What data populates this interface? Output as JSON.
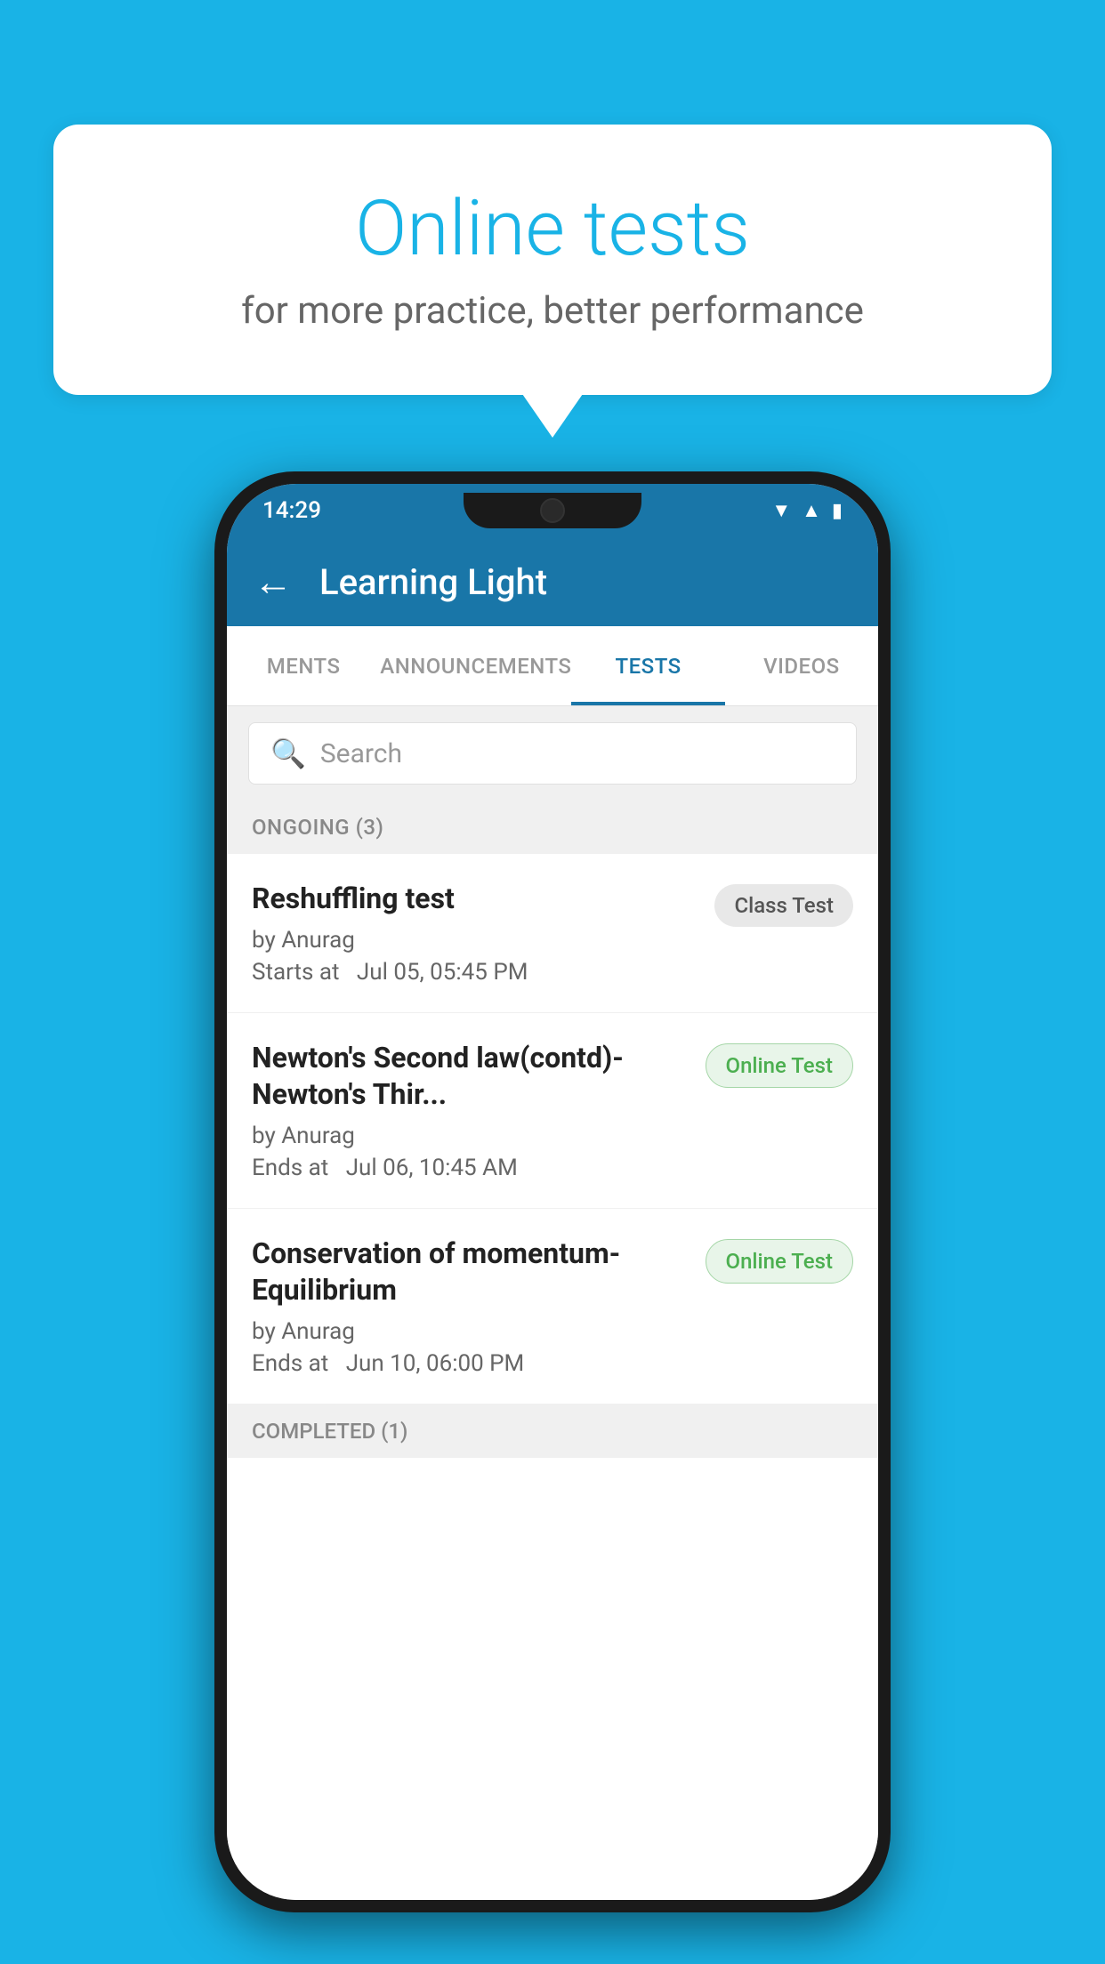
{
  "background": {
    "color": "#19b3e6"
  },
  "bubble": {
    "title": "Online tests",
    "subtitle": "for more practice, better performance"
  },
  "phone": {
    "statusBar": {
      "time": "14:29"
    },
    "appBar": {
      "title": "Learning Light",
      "backLabel": "←"
    },
    "tabs": [
      {
        "id": "ments",
        "label": "MENTS",
        "active": false
      },
      {
        "id": "announcements",
        "label": "ANNOUNCEMENTS",
        "active": false
      },
      {
        "id": "tests",
        "label": "TESTS",
        "active": true
      },
      {
        "id": "videos",
        "label": "VIDEOS",
        "active": false
      }
    ],
    "search": {
      "placeholder": "Search"
    },
    "ongoingSection": {
      "label": "ONGOING (3)"
    },
    "tests": [
      {
        "name": "Reshuffling test",
        "author": "by Anurag",
        "dateLabel": "Starts at",
        "date": "Jul 05, 05:45 PM",
        "badge": "Class Test",
        "badgeType": "class"
      },
      {
        "name": "Newton's Second law(contd)-Newton's Thir...",
        "author": "by Anurag",
        "dateLabel": "Ends at",
        "date": "Jul 06, 10:45 AM",
        "badge": "Online Test",
        "badgeType": "online"
      },
      {
        "name": "Conservation of momentum-Equilibrium",
        "author": "by Anurag",
        "dateLabel": "Ends at",
        "date": "Jun 10, 06:00 PM",
        "badge": "Online Test",
        "badgeType": "online"
      }
    ],
    "completedSection": {
      "label": "COMPLETED (1)"
    }
  }
}
